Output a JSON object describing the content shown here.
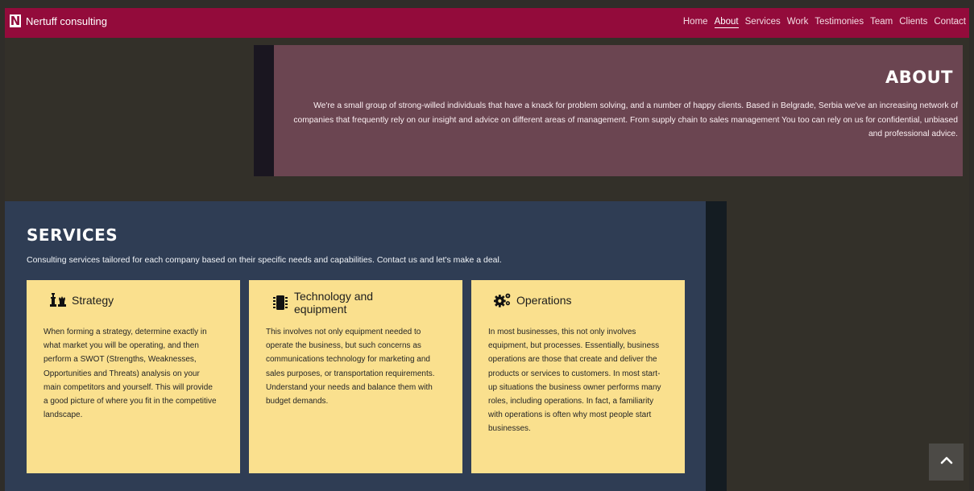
{
  "navbar": {
    "logo_letter": "N",
    "brand_name": "Nertuff consulting",
    "links": [
      "Home",
      "About",
      "Services",
      "Work",
      "Testimonies",
      "Team",
      "Clients",
      "Contact"
    ],
    "active_link": "About"
  },
  "about": {
    "title": "ABOUT",
    "text": "We're a small group of strong-willed individuals that have a knack for problem solving, and a number of happy clients. Based in Belgrade, Serbia we've an increasing network of companies that frequently rely on our insight and advice on different areas of management. From supply chain to sales management You too can rely on us for confidential, unbiased and professional advice."
  },
  "services": {
    "title": "SERVICES",
    "lead": "Consulting services tailored for each company based on their specific needs and capabilities. Contact us and let's make a deal.",
    "cards": [
      {
        "icon": "chess-icon",
        "title": "Strategy",
        "body": "When forming a strategy, determine exactly in what market you will be operating, and then perform a SWOT (Strengths, Weaknesses, Opportunities and Threats) analysis on your main competitors and yourself. This will provide a good picture of where you fit in the competitive landscape."
      },
      {
        "icon": "microchip-icon",
        "title": "Technology and equipment",
        "body": "This involves not only equipment needed to operate the business, but such concerns as communications technology for marketing and sales purposes, or transportation requirements. Understand your needs and balance them with budget demands."
      },
      {
        "icon": "gears-icon",
        "title": "Operations",
        "body": "In most businesses, this not only involves equipment, but processes. Essentially, business operations are those that create and deliver the products or services to customers. In most start-up situations the business owner performs many roles, including operations. In fact, a familiarity with operations is often why most people start businesses."
      }
    ]
  },
  "back_to_top": {
    "icon": "chevron-up-icon"
  },
  "colors": {
    "navbar": "#930b3b",
    "about_bg": "#6b4551",
    "services_bg": "#2f3d54",
    "card_bg": "#fae08e",
    "page_bg": "#333029"
  }
}
